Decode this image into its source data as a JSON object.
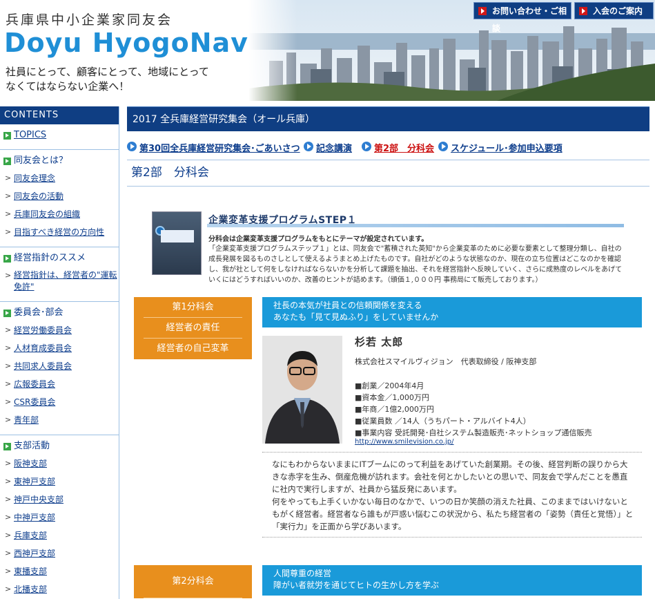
{
  "header": {
    "org_name": "兵庫県中小企業家同友会",
    "brand": "Doyu HyogoNavi",
    "tagline": "社員にとって、顧客にとって、地域にとって\nなくてはならない企業へ！",
    "contact_button": "お問い合わせ・ご相談",
    "join_button": "入会のご案内"
  },
  "sidebar": {
    "heading": "CONTENTS",
    "sections": [
      {
        "title": "TOPICS",
        "link": true,
        "items": []
      },
      {
        "title": "同友会とは？",
        "items": [
          "同友会理念",
          "同友会の活動",
          "兵庫同友会の組織",
          "目指すべき経営の方向性"
        ]
      },
      {
        "title": "経営指針のススメ",
        "items": [
          "経営指針は、経営者の\"運転免許\""
        ]
      },
      {
        "title": "委員会･部会",
        "items": [
          "経営労働委員会",
          "人材育成委員会",
          "共同求人委員会",
          "広報委員会",
          "CSR委員会",
          "青年部"
        ]
      },
      {
        "title": "支部活動",
        "items": [
          "阪神支部",
          "東神戸支部",
          "神戸中央支部",
          "中神戸支部",
          "兵庫支部",
          "西神戸支部",
          "東播支部",
          "北播支部"
        ]
      }
    ]
  },
  "main": {
    "title": "2017 全兵庫経営研究集会（オール兵庫）",
    "subnav": [
      "第30回全兵庫経営研究集会･ごあいさつ",
      "記念講演",
      "第2部　分科会",
      "スケジュール･参加申込要項"
    ],
    "active_subnav": "第2部　分科会",
    "section_title": "第2部　分科会",
    "program": {
      "title": "企業変革支援プログラムSTEP１",
      "lead": "分科会は企業変革支援プログラムをもとにテーマが設定されています。",
      "body": "「企業変革支援プログラムステップ１」とは、同友会で\"蓄積された英知\"から企業変革のために必要な要素として整理分類し、自社の成長発展を図るものさしとして使えるようまとめ上げたものです。自社がどのような状態なのか、現在の立ち位置はどこなのかを確認し、我が社として何をしなければならないかを分析して課題を抽出、それを経営指針へ反映していく、さらに成熟度のレベルをあげていくにはどうすればいいのか、改善のヒントが詰めます。（頒価１,０００円 事務局にて販売しております。）"
    },
    "sessions": [
      {
        "label": [
          "第1分科会",
          "経営者の責任",
          "経営者の自己変革"
        ],
        "banner": [
          "社長の本気が社員との信頼関係を変える",
          "あなたも「見て見ぬふり」をしていませんか"
        ],
        "speaker_name": "杉若 太郎",
        "company": "株式会社スマイルヴィジョン　代表取締役 / 阪神支部",
        "facts": [
          "■創業／2004年4月",
          "■資本金／1,000万円",
          "■年商／1億2,000万円",
          "■従業員数 ／14人（うちパート・アルバイト4人）",
          "■事業内容 受託開発･自社システム製造販売･ネットショップ通信販売"
        ],
        "url": "http://www.smilevision.co.jp/",
        "description": "なにもわからないままにITブームにのって利益をあげていた創業期。その後、経営判断の誤りから大きな赤字を生み、倒産危機が訪れます。会社を何とかしたいとの思いで、同友会で学んだことを愚直に社内で実行しますが、社員から猛反発にあいます。\n何をやっても上手くいかない毎日のなかで、いつの日か笑顔の消えた社員、このままではいけないともがく経営者。経営者なら誰もが戸惑い悩むこの状況から、私たち経営者の「姿勢（責任と覚悟）」と「実行力」を正面から学びあいます。"
      },
      {
        "label": [
          "第2分科会"
        ],
        "banner": [
          "人間尊重の経営",
          "障がい者就労を通じてヒトの生かし方を学ぶ"
        ]
      }
    ]
  },
  "colors": {
    "navy": "#0f3e83",
    "brand_blue": "#1f8fd6",
    "orange": "#e88f1d",
    "banner_blue": "#1a9ad9",
    "active_red": "#cc1111",
    "green": "#38a648"
  }
}
